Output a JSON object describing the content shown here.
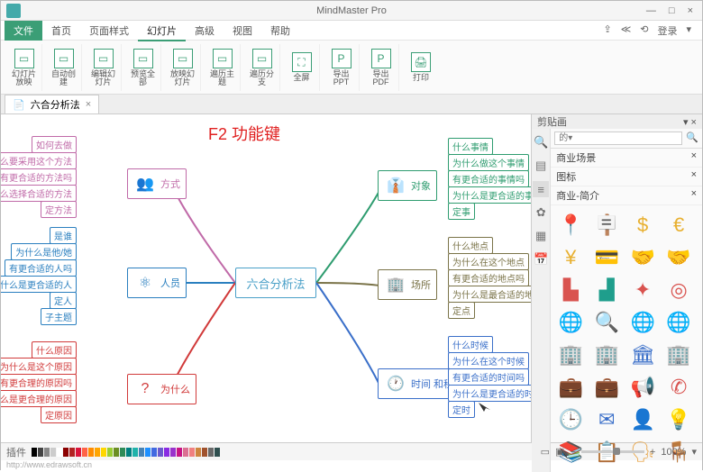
{
  "app": {
    "title": "MindMaster Pro"
  },
  "win": {
    "min": "—",
    "max": "□",
    "close": "×"
  },
  "menu": {
    "file": "文件",
    "items": [
      "首页",
      "页面样式",
      "幻灯片",
      "高级",
      "视图",
      "帮助"
    ],
    "active": 2,
    "right": {
      "cloud": "⇪",
      "share": "≪",
      "reload": "⟲",
      "login": "登录",
      "drop": "▾"
    }
  },
  "ribbon": [
    {
      "icon": "▭",
      "label": "幻灯片放映"
    },
    {
      "icon": "▭",
      "label": "自动创建"
    },
    {
      "icon": "▭",
      "label": "编辑幻灯片"
    },
    {
      "icon": "▭",
      "label": "预览全部"
    },
    {
      "icon": "▭",
      "label": "放映幻灯片"
    },
    {
      "icon": "▭",
      "label": "遍历主题"
    },
    {
      "icon": "▭",
      "label": "遍历分支"
    },
    {
      "icon": "⛶",
      "label": "全屏"
    },
    {
      "icon": "P",
      "label": "导出PPT"
    },
    {
      "icon": "P",
      "label": "导出PDF"
    },
    {
      "icon": "🖨",
      "label": "打印"
    }
  ],
  "doctab": {
    "name": "六合分析法",
    "close": "×"
  },
  "annotation": "F2 功能键",
  "center": "六合分析法",
  "branches": {
    "fangshi": {
      "label": "方式",
      "color": "#c06aa8",
      "subs": [
        "如何去做",
        "为什么要采用这个方法",
        "有更合适的方法吗",
        "为什么选择合适的方法",
        "定方法"
      ]
    },
    "renyuan": {
      "label": "人员",
      "color": "#2a7fbf",
      "subs": [
        "是谁",
        "为什么是他/她",
        "有更合适的人吗",
        "为什么是更合适的人",
        "定人",
        "子主题"
      ]
    },
    "weishenme": {
      "label": "为什么",
      "color": "#d13a3a",
      "subs": [
        "什么原因",
        "为什么是这个原因",
        "有更合理的原因吗",
        "为什么是更合理的原因",
        "定原因"
      ]
    },
    "duixiang": {
      "label": "对象",
      "color": "#2e9c6f",
      "subs": [
        "什么事情",
        "为什么做这个事情",
        "有更合适的事情吗",
        "为什么是更合适的事情",
        "定事"
      ]
    },
    "changsuo": {
      "label": "场所",
      "color": "#7a7348",
      "subs": [
        "什么地点",
        "为什么在这个地点",
        "有更合适的地点吗",
        "为什么是最合适的地点",
        "定点"
      ]
    },
    "shijian": {
      "label": "时间\n和程序",
      "color": "#3a6fc9",
      "subs": [
        "什么时候",
        "为什么在这个时候",
        "有更合适的时间吗",
        "为什么是更合适的时间",
        "定时"
      ]
    }
  },
  "rightpanel": {
    "title": "剪贴画",
    "searchPlaceholder": "的▾",
    "cats": [
      "商业场景",
      "图标",
      "商业-简介"
    ],
    "tabs": [
      "🔍",
      "▤",
      "≡",
      "✿",
      "▦",
      "📅"
    ],
    "clips": [
      {
        "g": "📍",
        "c": "#e8a64a"
      },
      {
        "g": "🪧",
        "c": "#e8a64a"
      },
      {
        "g": "$",
        "c": "#e8b030"
      },
      {
        "g": "€",
        "c": "#e8b030"
      },
      {
        "g": "¥",
        "c": "#e8b030"
      },
      {
        "g": "💳",
        "c": "#555"
      },
      {
        "g": "🤝",
        "c": "#e8a64a"
      },
      {
        "g": "🤝",
        "c": "#555"
      },
      {
        "g": "▙",
        "c": "#d9534f"
      },
      {
        "g": "▟",
        "c": "#1f9e8c"
      },
      {
        "g": "✦",
        "c": "#d9534f"
      },
      {
        "g": "◎",
        "c": "#d9534f"
      },
      {
        "g": "🌐",
        "c": "#1f9e8c"
      },
      {
        "g": "🔍",
        "c": "#1f9e8c"
      },
      {
        "g": "🌐",
        "c": "#3a6fc9"
      },
      {
        "g": "🌐",
        "c": "#1f9e8c"
      },
      {
        "g": "🏢",
        "c": "#3a6fc9"
      },
      {
        "g": "🏢",
        "c": "#1f9e8c"
      },
      {
        "g": "🏛",
        "c": "#3a6fc9"
      },
      {
        "g": "🏢",
        "c": "#3a6fc9"
      },
      {
        "g": "💼",
        "c": "#3a6fc9"
      },
      {
        "g": "💼",
        "c": "#1f9e8c"
      },
      {
        "g": "📢",
        "c": "#d9534f"
      },
      {
        "g": "✆",
        "c": "#d9534f"
      },
      {
        "g": "🕒",
        "c": "#e8a64a"
      },
      {
        "g": "✉",
        "c": "#3a6fc9"
      },
      {
        "g": "👤",
        "c": "#e8a64a"
      },
      {
        "g": "💡",
        "c": "#1f9e8c"
      },
      {
        "g": "📚",
        "c": "#e8a64a"
      },
      {
        "g": "📋",
        "c": "#999"
      },
      {
        "g": "🗣",
        "c": "#e8a64a"
      },
      {
        "g": "🪑",
        "c": "#999"
      }
    ]
  },
  "status": {
    "label": "插件",
    "zoom": "100%",
    "url": "http://www.edrawsoft.cn"
  }
}
